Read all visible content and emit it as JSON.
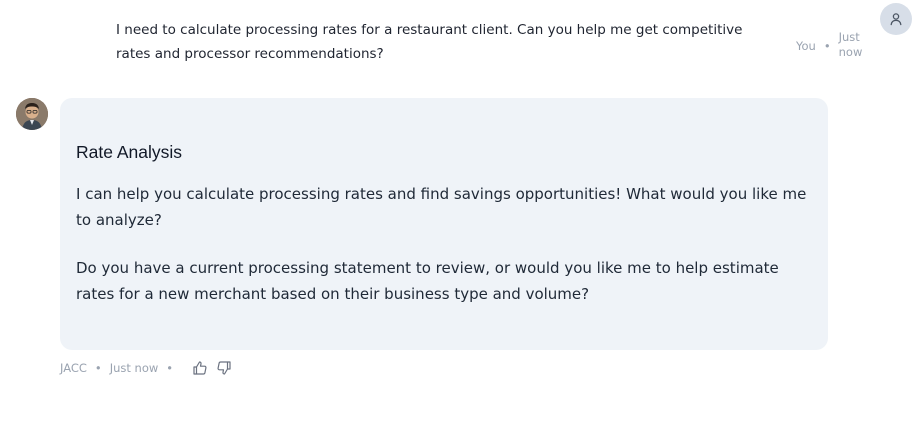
{
  "user_message": {
    "text": "I need to calculate processing rates for a restaurant client. Can you help me get competitive rates and processor recommendations?",
    "sender": "You",
    "time": "Just now"
  },
  "assistant_message": {
    "title": "Rate Analysis",
    "paragraphs": [
      "I can help you calculate processing rates and find savings opportunities! What would you like me to analyze?",
      "Do you have a current processing statement to review, or would you like me to help estimate rates for a new merchant based on their business type and volume?"
    ],
    "sender": "JACC",
    "time": "Just now"
  },
  "icons": {
    "user_avatar": "user-icon",
    "bot_avatar": "assistant-avatar",
    "like": "thumbs-up-icon",
    "dislike": "thumbs-down-icon"
  }
}
